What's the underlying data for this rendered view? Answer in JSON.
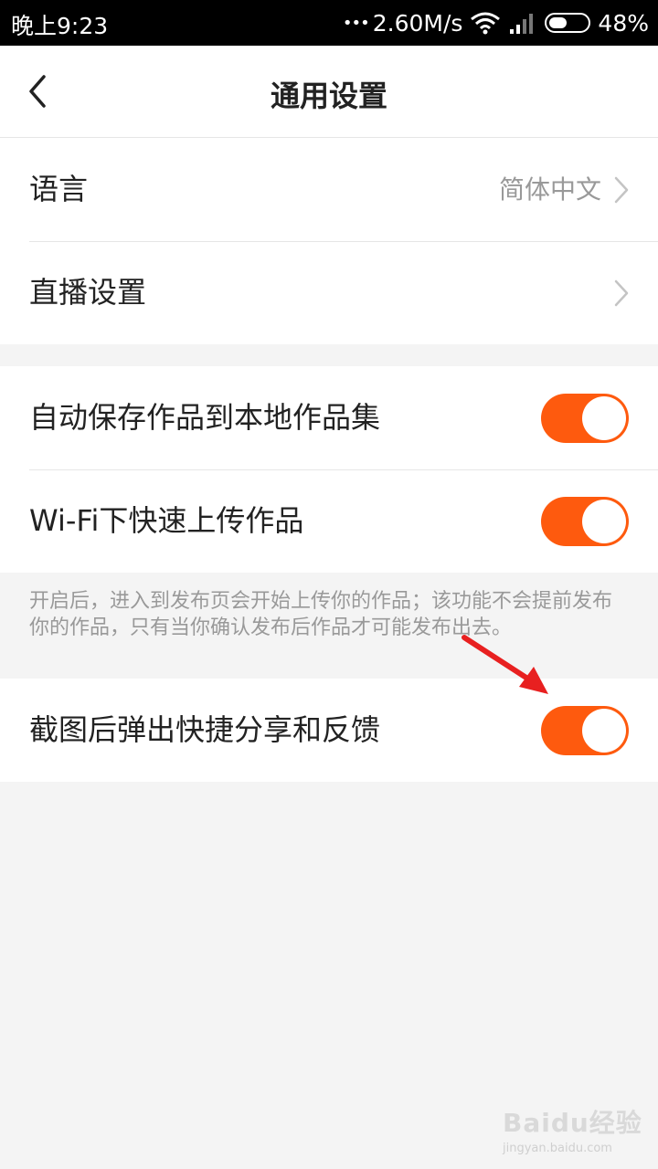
{
  "status_bar": {
    "time": "晚上9:23",
    "dots": "•••",
    "network_speed": "2.60M/s",
    "battery_level": 0.48,
    "battery_percent": "48%",
    "icons": [
      "wifi-icon",
      "signal-icon",
      "battery-icon"
    ]
  },
  "header": {
    "title": "通用设置",
    "back_icon": "chevron-left-icon"
  },
  "settings": {
    "language": {
      "label": "语言",
      "value": "简体中文"
    },
    "live": {
      "label": "直播设置"
    },
    "auto_save": {
      "label": "自动保存作品到本地作品集",
      "on": true
    },
    "wifi_upload": {
      "label": "Wi-Fi下快速上传作品",
      "on": true
    },
    "wifi_note": "开启后，进入到发布页会开始上传你的作品；该功能不会提前发布你的作品，只有当你确认发布后作品才可能发布出去。",
    "screenshot_share": {
      "label": "截图后弹出快捷分享和反馈",
      "on": true
    }
  },
  "colors": {
    "accent": "#fe5a0e",
    "annotation_arrow": "#e82020"
  },
  "watermark": {
    "logo": "Baidu经验",
    "url": "jingyan.baidu.com"
  }
}
